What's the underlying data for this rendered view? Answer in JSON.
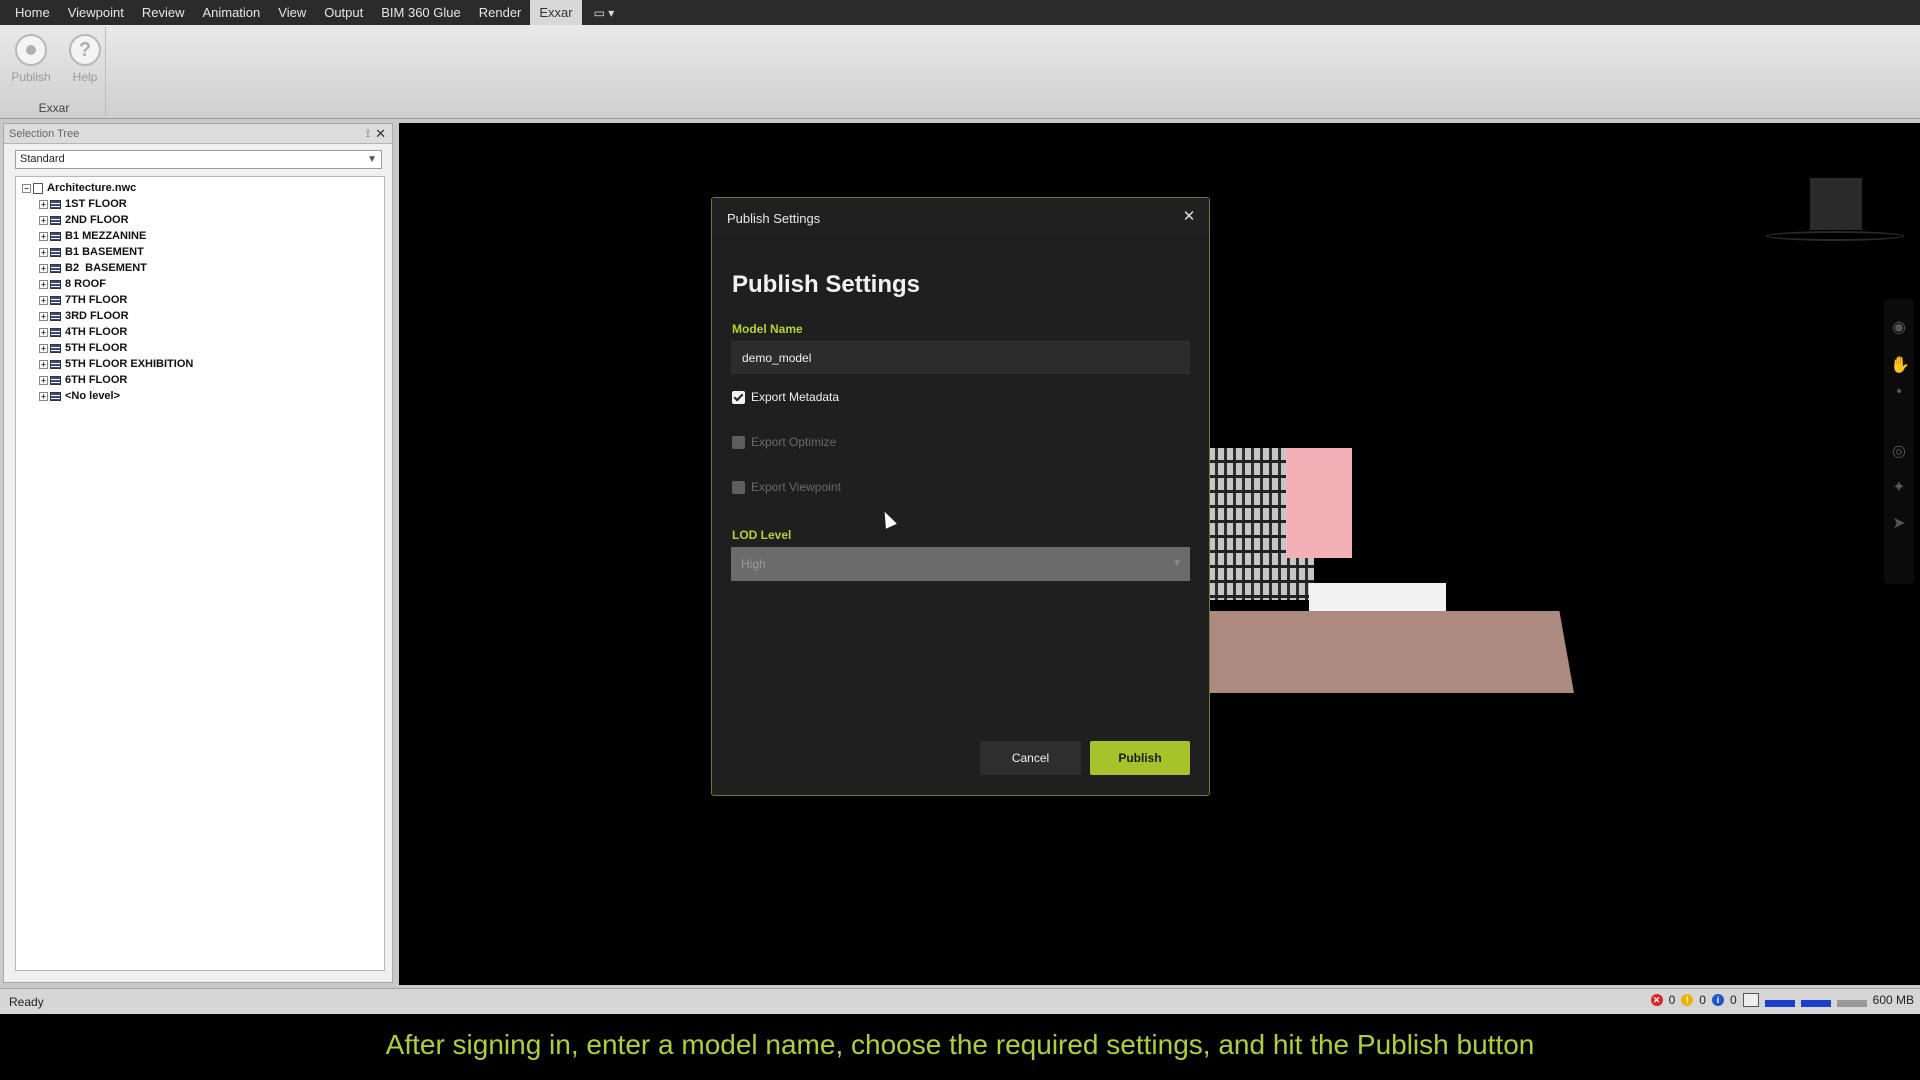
{
  "menubar": {
    "items": [
      {
        "label": "Home",
        "active": false
      },
      {
        "label": "Viewpoint",
        "active": false
      },
      {
        "label": "Review",
        "active": false
      },
      {
        "label": "Animation",
        "active": false
      },
      {
        "label": "View",
        "active": false
      },
      {
        "label": "Output",
        "active": false
      },
      {
        "label": "BIM 360 Glue",
        "active": false
      },
      {
        "label": "Render",
        "active": false
      },
      {
        "label": "Exxar",
        "active": true
      }
    ]
  },
  "ribbon": {
    "publish_label": "Publish",
    "help_label": "Help",
    "group_label": "Exxar"
  },
  "selection_tree": {
    "title": "Selection Tree",
    "mode": "Standard",
    "root": "Architecture.nwc",
    "levels": [
      "1ST FLOOR",
      "2ND FLOOR",
      "B1 MEZZANINE",
      "B1 BASEMENT",
      "B2  BASEMENT",
      "8 ROOF",
      "7TH FLOOR",
      "3RD FLOOR",
      "4TH FLOOR",
      "5TH FLOOR",
      "5TH FLOOR EXHIBITION",
      "6TH FLOOR",
      "<No level>"
    ]
  },
  "dialog": {
    "window_title": "Publish Settings",
    "heading": "Publish Settings",
    "model_name_label": "Model Name",
    "model_name_value": "demo_model",
    "export_metadata_label": "Export Metadata",
    "export_metadata_checked": true,
    "export_optimize_label": "Export Optimize",
    "export_optimize_checked": false,
    "export_viewpoint_label": "Export Viewpoint",
    "export_viewpoint_checked": false,
    "lod_label": "LOD Level",
    "lod_value": "High",
    "cancel_label": "Cancel",
    "publish_label": "Publish"
  },
  "statusbar": {
    "status": "Ready",
    "errors": "0",
    "warnings": "0",
    "info": "0",
    "memory": "600 MB"
  },
  "caption": "After signing in, enter a model name, choose the required settings, and hit the Publish button",
  "colors": {
    "accent": "#a6c32c",
    "label": "#b4d038",
    "dialog_bg": "#1f1f1f"
  }
}
